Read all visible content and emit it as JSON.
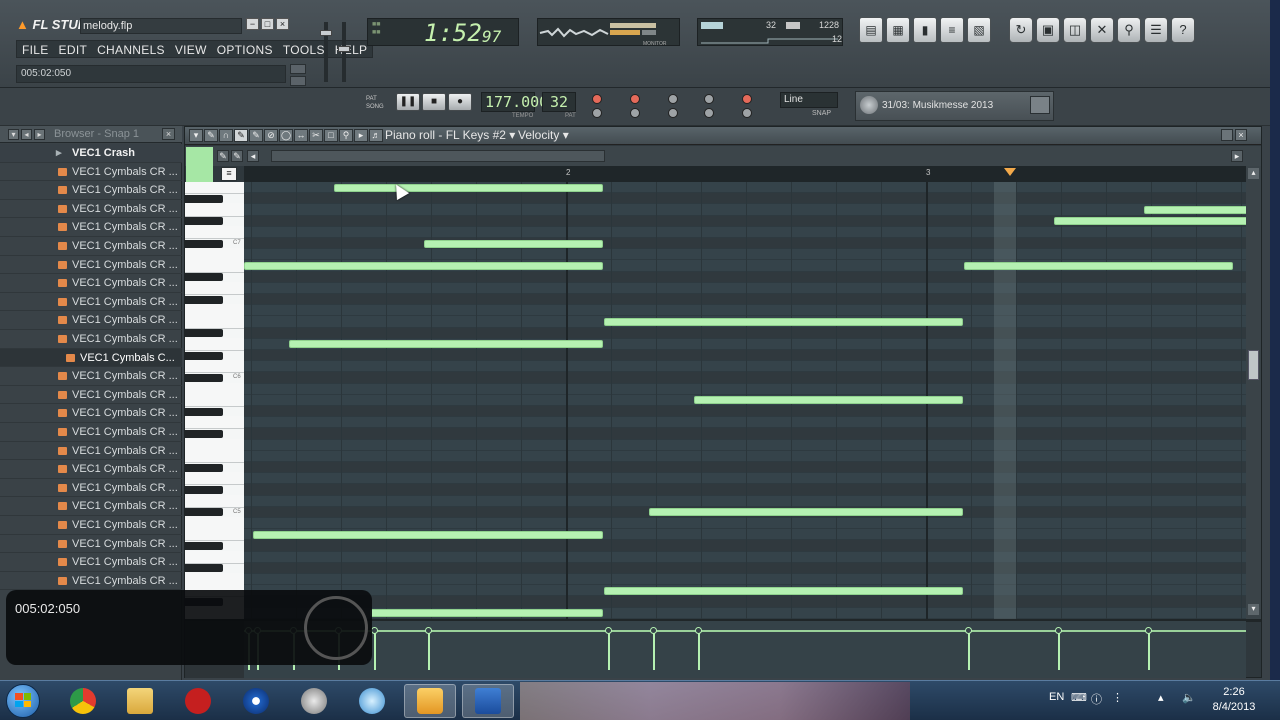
{
  "app": {
    "logo": "FL STUDIO",
    "project_file": "melody.flp",
    "menu": [
      "FILE",
      "EDIT",
      "CHANNELS",
      "VIEW",
      "OPTIONS",
      "TOOLS",
      "HELP"
    ],
    "hint": "005:02:050"
  },
  "display": {
    "time_main": "1:52",
    "time_ms": "97",
    "cpu_value": "32",
    "mem_value": "1228",
    "poly_value": "12",
    "monitor_label": "MONITOR"
  },
  "transport": {
    "pat_label": "PAT",
    "song_label": "SONG",
    "tempo": "177.000",
    "tempo_label": "TEMPO",
    "pattern": "32",
    "pattern_label": "PAT",
    "snap": "Line",
    "snap_label": "SNAP",
    "news": "31/03: Musikmesse 2013"
  },
  "browser": {
    "title": "Browser - Snap 1",
    "header_item": "VEC1 Crash",
    "items": [
      "VEC1 Cymbals CR ...",
      "VEC1 Cymbals CR ...",
      "VEC1 Cymbals CR ...",
      "VEC1 Cymbals CR ...",
      "VEC1 Cymbals CR ...",
      "VEC1 Cymbals CR ...",
      "VEC1 Cymbals CR ...",
      "VEC1 Cymbals CR ...",
      "VEC1 Cymbals CR ...",
      "VEC1 Cymbals CR ...",
      "VEC1 Cymbals C...",
      "VEC1 Cymbals CR ...",
      "VEC1 Cymbals CR ...",
      "VEC1 Cymbals CR ...",
      "VEC1 Cymbals CR ...",
      "VEC1 Cymbals CR ...",
      "VEC1 Cymbals CR ...",
      "VEC1 Cymbals CR ...",
      "VEC1 Cymbals CR ...",
      "VEC1 Cymbals CR ...",
      "VEC1 Cymbals CR ...",
      "VEC1 Cymbals CR ...",
      "VEC1 Cymbals CR ..."
    ],
    "selected_index": 10
  },
  "piano_roll": {
    "title": "Piano roll - FL Keys #2",
    "target": "Velocity",
    "bar_labels": [
      "2",
      "3"
    ],
    "octave_labels": [
      "C7",
      "C6",
      "C5"
    ],
    "note_color": "#b5f1b2"
  },
  "notes": [
    {
      "row": 0,
      "start": 0.25,
      "len": 0.75
    },
    {
      "row": 2,
      "start": 2.5,
      "len": 0.5
    },
    {
      "row": 3,
      "start": 2.25,
      "len": 0.75
    },
    {
      "row": 3,
      "start": 3.0,
      "len": 0.89
    },
    {
      "row": 5,
      "start": 0.5,
      "len": 0.5
    },
    {
      "row": 7,
      "start": 0.0,
      "len": 1.0
    },
    {
      "row": 7,
      "start": 2.0,
      "len": 0.75
    },
    {
      "row": 7,
      "start": 3.25,
      "len": 0.64
    },
    {
      "row": 8,
      "start": 3.375,
      "len": 0.515
    },
    {
      "row": 12,
      "start": 1.0,
      "len": 1.0
    },
    {
      "row": 14,
      "start": 0.125,
      "len": 0.875
    },
    {
      "row": 19,
      "start": 1.25,
      "len": 0.75
    },
    {
      "row": 19,
      "start": 3.25,
      "len": 0.64
    },
    {
      "row": 27,
      "start": 3.125,
      "len": 0.765
    },
    {
      "row": 29,
      "start": 1.125,
      "len": 0.875
    },
    {
      "row": 31,
      "start": 0.025,
      "len": 0.975
    },
    {
      "row": 34,
      "start": 3.0,
      "len": 0.89
    },
    {
      "row": 36,
      "start": 1.0,
      "len": 1.0
    },
    {
      "row": 38,
      "start": 0.35,
      "len": 0.65
    }
  ],
  "overlay": {
    "time": "005:02:050"
  },
  "taskbar": {
    "language": "EN",
    "time": "2:26",
    "date": "8/4/2013"
  }
}
